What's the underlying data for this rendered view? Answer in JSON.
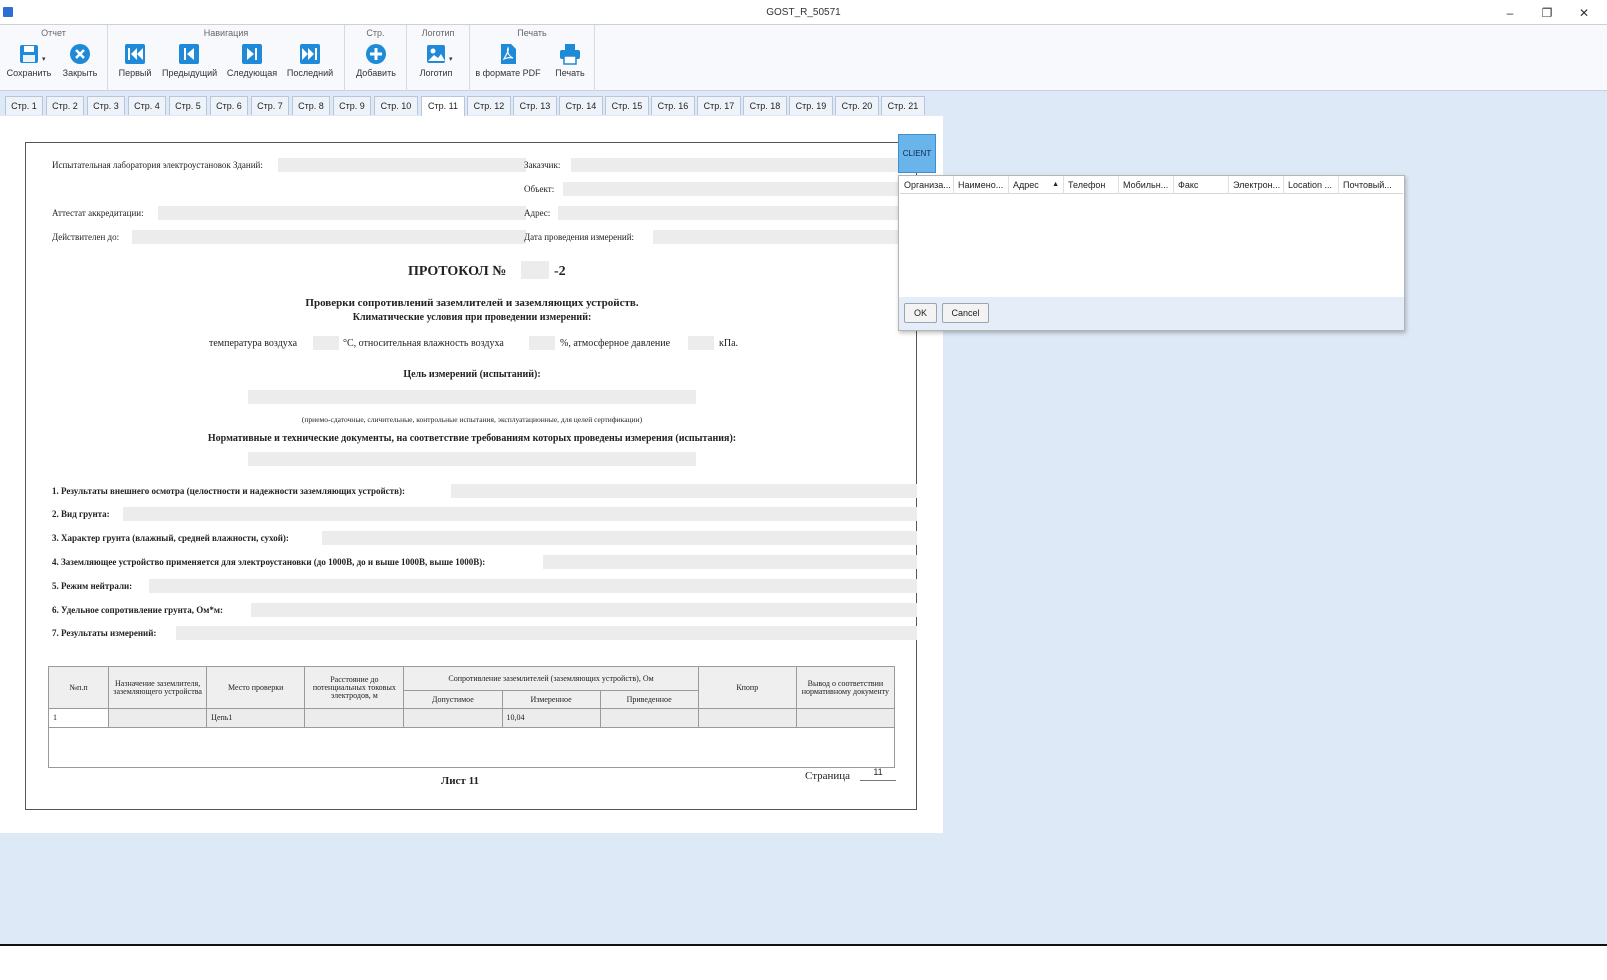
{
  "window": {
    "title": "GOST_R_50571",
    "minimize": "–",
    "restore": "❐",
    "close": "✕"
  },
  "ribbon": {
    "groups": [
      {
        "title": "Отчет",
        "buttons": [
          "Сохранить",
          "Закрыть"
        ]
      },
      {
        "title": "Навигация",
        "buttons": [
          "Первый",
          "Предыдущий",
          "Следующая",
          "Последний"
        ]
      },
      {
        "title": "Стр.",
        "buttons": [
          "Добавить"
        ]
      },
      {
        "title": "Логотип",
        "buttons": [
          "Логотип"
        ]
      },
      {
        "title": "Печать",
        "buttons": [
          "в формате PDF",
          "Печать"
        ]
      }
    ]
  },
  "tabs": [
    "Стр. 1",
    "Стр. 2",
    "Стр. 3",
    "Стр. 4",
    "Стр. 5",
    "Стр. 6",
    "Стр. 7",
    "Стр. 8",
    "Стр. 9",
    "Стр. 10",
    "Стр. 11",
    "Стр. 12",
    "Стр. 13",
    "Стр. 14",
    "Стр. 15",
    "Стр. 16",
    "Стр. 17",
    "Стр. 18",
    "Стр. 19",
    "Стр. 20",
    "Стр. 21"
  ],
  "active_tab": "Стр. 11",
  "sheet": {
    "lab_label": "Испытательная лаборатория электроустановок Зданий:",
    "attest_label": "Аттестат аккредитации:",
    "valid_label": "Действителен до:",
    "customer_label": "Заказчик:",
    "object_label": "Объект:",
    "address_label": "Адрес:",
    "date_label": "Дата проведения измерений:",
    "protocol_prefix": "ПРОТОКОЛ №",
    "protocol_suffix": "-2",
    "subtitle1": "Проверки сопротивлений заземлителей и заземляющих устройств.",
    "subtitle2": "Климатические условия при проведении измерений:",
    "climate_temp": "температура воздуха",
    "climate_c": "°С, относительная влажность воздуха",
    "climate_pct": "%, атмосферное давление",
    "climate_kpa": "кПа.",
    "goal_title": "Цель измерений (испытаний):",
    "goal_hint": "(приемо-сдаточные, сличительные, контрольные испытания, эксплуатационные, для целей сертификации)",
    "docs_title": "Нормативные и технические документы, на соответствие требованиям которых проведены измерения (испытания):",
    "items": [
      "1. Результаты внешнего осмотра (целостности и надежности заземляющих устройств):",
      "2. Вид грунта:",
      "3. Характер грунта (влажный, средней влажности, сухой):",
      "4. Заземляющее устройство применяется для электроустановки (до 1000В, до и выше 1000В, выше 1000В):",
      "5. Режим нейтрали:",
      "6. Удельное сопротивление грунта, Ом*м:",
      "7. Результаты измерений:"
    ],
    "table": {
      "h_num": "№п.п",
      "h_purpose": "Назначение заземлителя, заземляющего устройства",
      "h_place": "Место проверки",
      "h_distance": "Расстояние до потенциальных токовых электродов, м",
      "h_resistance": "Сопротивление заземлителей (заземляющих устройств), Ом",
      "h_allowed": "Допустимое",
      "h_measured": "Измеренное",
      "h_reduced": "Приведенное",
      "h_kcoef": "Кпопр",
      "h_conclusion": "Вывод о соответствии нормативному документу",
      "row": {
        "num": "1",
        "place": "Цепь1",
        "measured": "10,04"
      }
    },
    "sheet_label": "Лист 11",
    "page_label": "Страница",
    "page_value": "11"
  },
  "client_button": "CLIENT",
  "popup": {
    "columns": [
      "Организа...",
      "Наимено...",
      "Адрес",
      "Телефон",
      "Мобильн...",
      "Факс",
      "Электрон...",
      "Location ...",
      "Почтовый..."
    ],
    "ok": "OK",
    "cancel": "Cancel"
  },
  "colors": {
    "accent": "#1f8ad8",
    "ribbon_bg": "#f7f9fc",
    "workspace": "#dde9f6"
  }
}
